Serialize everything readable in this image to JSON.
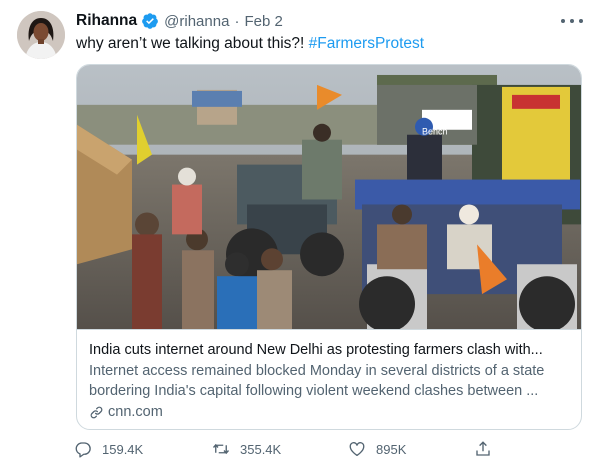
{
  "tweet": {
    "author_name": "Rihanna",
    "handle": "@rihanna",
    "separator": "·",
    "date": "Feb 2",
    "text_plain": "why aren’t we talking about this?! ",
    "hashtag": "#FarmersProtest"
  },
  "card": {
    "title": "India cuts internet around New Delhi as protesting farmers clash with...",
    "description": "Internet access remained blocked Monday in several districts of a state bordering India's capital following violent weekend clashes between ...",
    "domain": "cnn.com",
    "image_sign_text": "Bench"
  },
  "actions": {
    "replies": "159.4K",
    "retweets": "355.4K",
    "likes": "895K"
  },
  "icons": {
    "verified": "verified-badge-icon",
    "more": "more-options-icon",
    "link": "link-icon",
    "reply": "reply-icon",
    "retweet": "retweet-icon",
    "like": "heart-icon",
    "share": "share-icon"
  },
  "colors": {
    "accent": "#1d9bf0",
    "text": "#0f1419",
    "secondary": "#536471",
    "border": "#cfd9de"
  }
}
